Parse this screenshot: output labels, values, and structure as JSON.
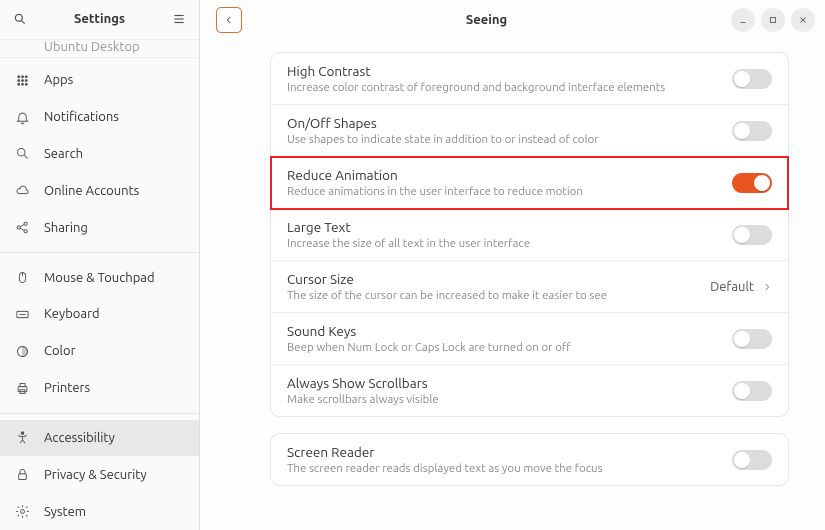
{
  "sidebar": {
    "title": "Settings",
    "partial": "Ubuntu Desktop",
    "items": [
      {
        "label": "Apps"
      },
      {
        "label": "Notifications"
      },
      {
        "label": "Search"
      },
      {
        "label": "Online Accounts"
      },
      {
        "label": "Sharing"
      }
    ],
    "items2": [
      {
        "label": "Mouse & Touchpad"
      },
      {
        "label": "Keyboard"
      },
      {
        "label": "Color"
      },
      {
        "label": "Printers"
      }
    ],
    "items3": [
      {
        "label": "Accessibility"
      },
      {
        "label": "Privacy & Security"
      },
      {
        "label": "System"
      }
    ]
  },
  "page": {
    "title": "Seeing"
  },
  "rows": {
    "highcontrast": {
      "title": "High Contrast",
      "desc": "Increase color contrast of foreground and background interface elements"
    },
    "onoff": {
      "title": "On/Off Shapes",
      "desc": "Use shapes to indicate state in addition to or instead of color"
    },
    "reduce": {
      "title": "Reduce Animation",
      "desc": "Reduce animations in the user interface to reduce motion"
    },
    "large": {
      "title": "Large Text",
      "desc": "Increase the size of all text in the user interface"
    },
    "cursor": {
      "title": "Cursor Size",
      "desc": "The size of the cursor can be increased to make it easier to see",
      "value": "Default"
    },
    "sound": {
      "title": "Sound Keys",
      "desc": "Beep when Num Lock or Caps Lock are turned on or off"
    },
    "scroll": {
      "title": "Always Show Scrollbars",
      "desc": "Make scrollbars always visible"
    },
    "reader": {
      "title": "Screen Reader",
      "desc": "The screen reader reads displayed text as you move the focus"
    }
  }
}
